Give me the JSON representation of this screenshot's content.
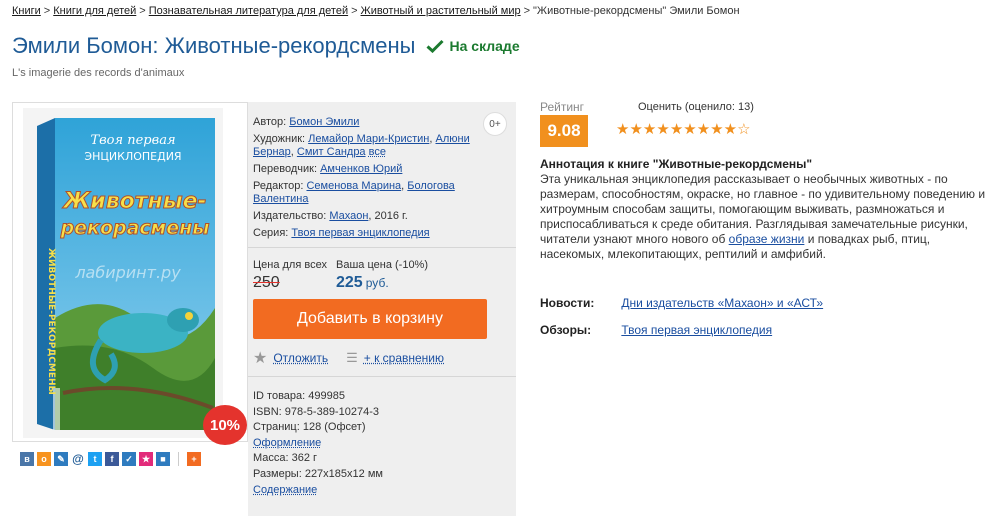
{
  "breadcrumb": {
    "items": [
      "Книги",
      "Книги для детей",
      "Познавательная литература для детей",
      "Животный и растительный мир"
    ],
    "current": "\"Животные-рекордсмены\" Эмили Бомон",
    "separator": ">"
  },
  "book": {
    "title": "Эмили Бомон: Животные-рекордсмены",
    "original_title": "L's imagerie des records d'animaux",
    "stock": "На складе",
    "discount_badge": "10%",
    "age_badge": "0+"
  },
  "cover": {
    "series_top": "Твоя первая",
    "series_bottom": "ЭНЦИКЛОПЕДИЯ",
    "title_line1": "Животные-",
    "title_line2": "рекорасмены",
    "spine": "ЖИВОТНЫЕ-РЕКОРДСМЕНЫ",
    "watermark": "лабиринт.ру"
  },
  "attributes": {
    "author_label": "Автор:",
    "author": "Бомон Эмили",
    "artist_label": "Художник:",
    "artist_1": "Лемайор Мари-Кристин",
    "artist_2": "Алюни Бернар",
    "artist_3": "Смит Сандра",
    "artist_all": "все",
    "translator_label": "Переводчик:",
    "translator": "Амченков Юрий",
    "editor_label": "Редактор:",
    "editor_1": "Семенова Марина",
    "editor_2": "Бологова Валентина",
    "publisher_label": "Издательство:",
    "publisher": "Махаон",
    "year": ", 2016 г.",
    "series_label": "Серия:",
    "series": "Твоя первая энциклопедия"
  },
  "price": {
    "list_label": "Цена для всех",
    "list_value": "250",
    "your_label": "Ваша цена (-10%)",
    "your_value": "225",
    "currency": "руб.",
    "cart_button": "Добавить в корзину",
    "defer": "Отложить",
    "compare": "+ к сравнению"
  },
  "details": {
    "id": "ID товара: 499985",
    "isbn": "ISBN: 978-5-389-10274-3",
    "pages": "Страниц: 128 (Офсет)",
    "design_link": "Оформление",
    "weight": "Масса: 362 г",
    "size": "Размеры: 227x185x12 мм",
    "contents_link": "Содержание"
  },
  "rating": {
    "label": "Рейтинг",
    "score": "9.08",
    "vote_label": "Оценить (оценило: 13)",
    "stars_filled": 9,
    "stars_total": 10
  },
  "annotation": {
    "heading": "Аннотация к книге \"Животные-рекордсмены\"",
    "text_before": "Эта уникальная энциклопедия рассказывает о необычных животных - по размерам, способностям, окраске, но главное - по удивительному поведению и хитроумным способам защиты, помогающим выживать, размножаться и приспосабливаться к среде обитания. Разглядывая замечательные рисунки, читатели узнают много нового об ",
    "link": "образе жизни",
    "text_after": " и повадках рыб, птиц, насекомых, млекопитающих, рептилий и амфибий."
  },
  "news": {
    "label": "Новости:",
    "link": "Дни издательств «Махаон» и «АСТ»"
  },
  "reviews": {
    "label": "Обзоры:",
    "link": "Твоя первая энциклопедия"
  },
  "colors": {
    "title_blue": "#1f5b96",
    "in_stock_green": "#1b7a2f",
    "cart_orange": "#f26b21",
    "rating_orange": "#f1901e",
    "discount_red": "#e4332d"
  },
  "share_icons": [
    "vk-icon",
    "odnoklassniki-icon",
    "livejournal-icon",
    "mail-icon",
    "twitter-icon",
    "facebook-icon",
    "bookmark-icon",
    "star-icon",
    "myworld-icon",
    "plus-icon"
  ]
}
